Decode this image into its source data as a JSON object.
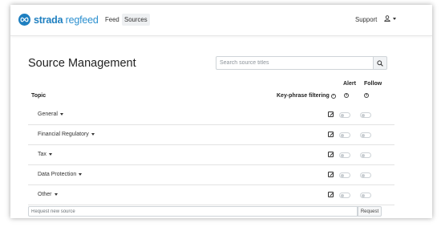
{
  "header": {
    "brand_main": "strada",
    "brand_sub": "regfeed",
    "nav": [
      {
        "label": "Feed"
      },
      {
        "label": "Sources"
      }
    ],
    "support_label": "Support",
    "user_icon": "user-icon"
  },
  "page": {
    "title": "Source Management",
    "search_placeholder": "Search source titles"
  },
  "table": {
    "col_topic": "Topic",
    "col_key": "Key-phrase filtering",
    "col_alert": "Alert",
    "col_follow": "Follow",
    "help_glyph": "?",
    "rows": [
      {
        "label": "General"
      },
      {
        "label": "Financial Regulatory"
      },
      {
        "label": "Tax"
      },
      {
        "label": "Data Protection"
      },
      {
        "label": "Other"
      }
    ]
  },
  "request": {
    "placeholder": "Request new source",
    "button_label": "Request"
  },
  "colors": {
    "brand": "#1e7fc0",
    "border": "#cfd4d8"
  }
}
